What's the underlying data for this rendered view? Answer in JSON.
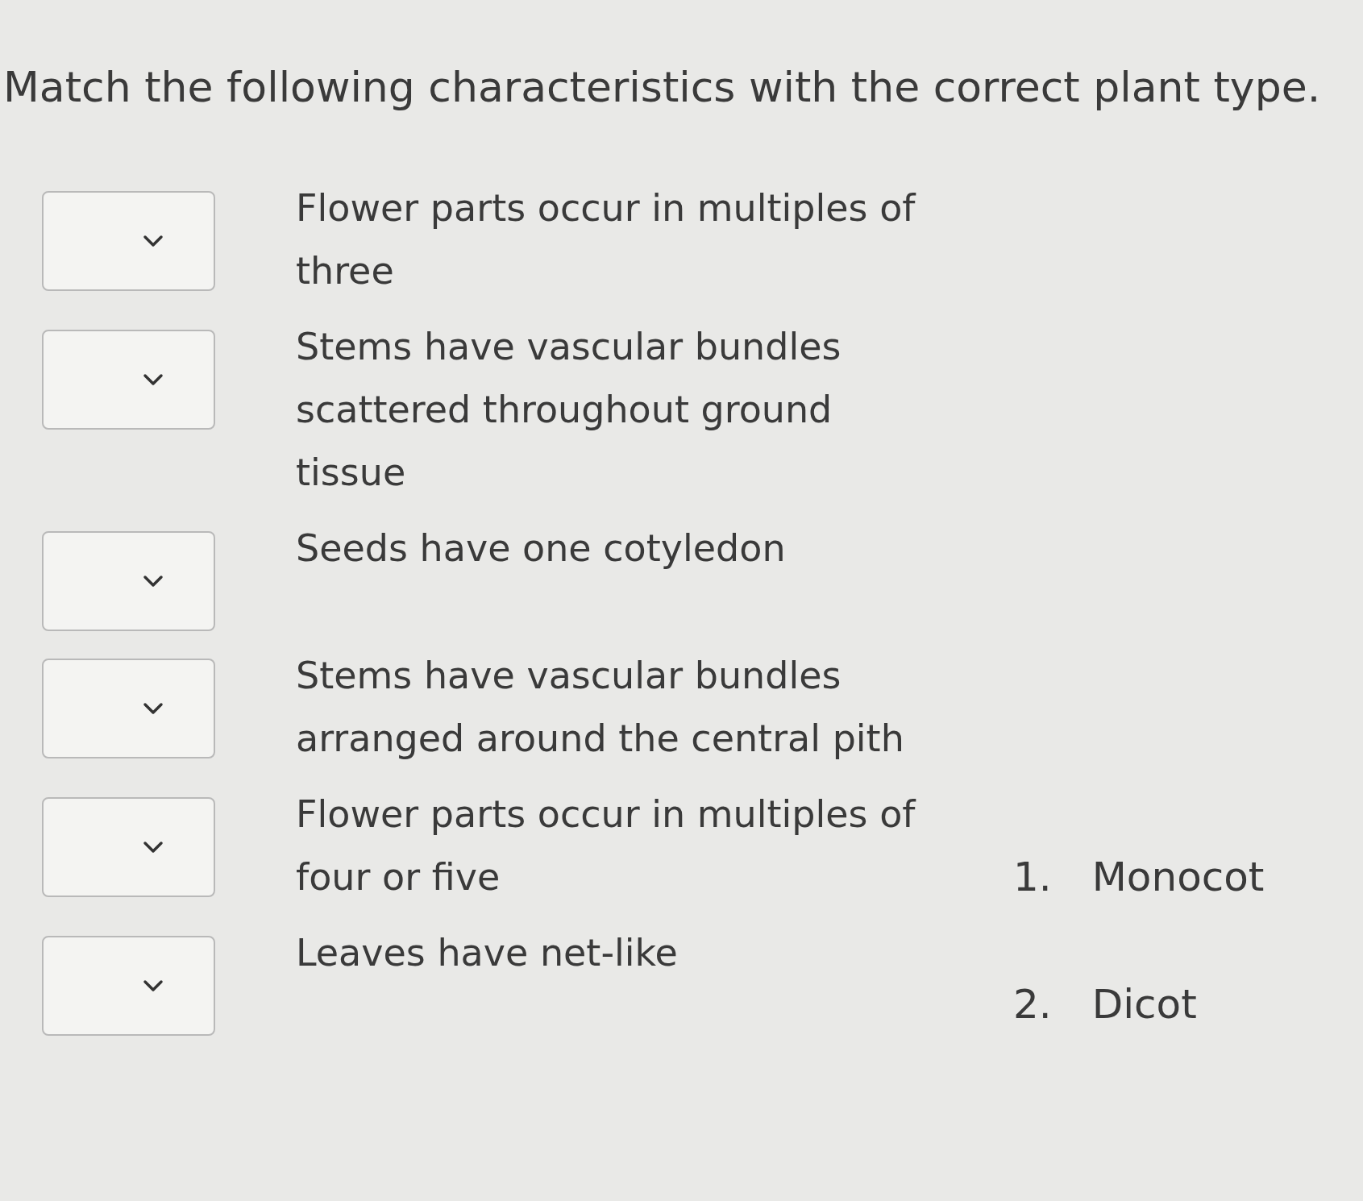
{
  "question": {
    "prompt": "Match the following characteristics with the correct plant type."
  },
  "characteristics": [
    {
      "text": "Flower parts occur in multiples of three"
    },
    {
      "text": "Stems have vascular bundles scattered throughout ground tissue"
    },
    {
      "text": "Seeds have one cotyledon"
    },
    {
      "text": "Stems have vascular bundles arranged around the central pith"
    },
    {
      "text": "Flower parts occur in multiples of four or five"
    },
    {
      "text": "Leaves have net-like"
    }
  ],
  "options": [
    {
      "number": "1.",
      "label": "Monocot"
    },
    {
      "number": "2.",
      "label": "Dicot"
    }
  ]
}
